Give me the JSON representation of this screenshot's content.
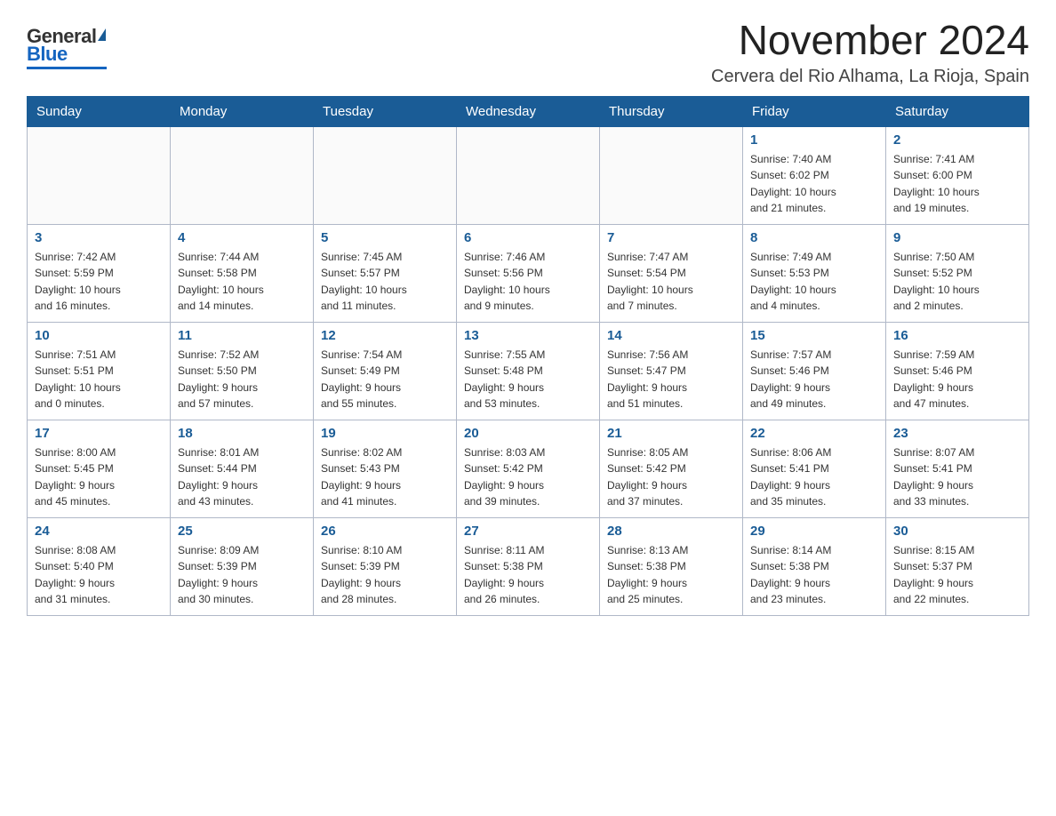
{
  "header": {
    "logo_general": "General",
    "logo_blue": "Blue",
    "month_title": "November 2024",
    "location": "Cervera del Rio Alhama, La Rioja, Spain"
  },
  "days_of_week": [
    "Sunday",
    "Monday",
    "Tuesday",
    "Wednesday",
    "Thursday",
    "Friday",
    "Saturday"
  ],
  "weeks": [
    [
      {
        "day": "",
        "info": ""
      },
      {
        "day": "",
        "info": ""
      },
      {
        "day": "",
        "info": ""
      },
      {
        "day": "",
        "info": ""
      },
      {
        "day": "",
        "info": ""
      },
      {
        "day": "1",
        "info": "Sunrise: 7:40 AM\nSunset: 6:02 PM\nDaylight: 10 hours\nand 21 minutes."
      },
      {
        "day": "2",
        "info": "Sunrise: 7:41 AM\nSunset: 6:00 PM\nDaylight: 10 hours\nand 19 minutes."
      }
    ],
    [
      {
        "day": "3",
        "info": "Sunrise: 7:42 AM\nSunset: 5:59 PM\nDaylight: 10 hours\nand 16 minutes."
      },
      {
        "day": "4",
        "info": "Sunrise: 7:44 AM\nSunset: 5:58 PM\nDaylight: 10 hours\nand 14 minutes."
      },
      {
        "day": "5",
        "info": "Sunrise: 7:45 AM\nSunset: 5:57 PM\nDaylight: 10 hours\nand 11 minutes."
      },
      {
        "day": "6",
        "info": "Sunrise: 7:46 AM\nSunset: 5:56 PM\nDaylight: 10 hours\nand 9 minutes."
      },
      {
        "day": "7",
        "info": "Sunrise: 7:47 AM\nSunset: 5:54 PM\nDaylight: 10 hours\nand 7 minutes."
      },
      {
        "day": "8",
        "info": "Sunrise: 7:49 AM\nSunset: 5:53 PM\nDaylight: 10 hours\nand 4 minutes."
      },
      {
        "day": "9",
        "info": "Sunrise: 7:50 AM\nSunset: 5:52 PM\nDaylight: 10 hours\nand 2 minutes."
      }
    ],
    [
      {
        "day": "10",
        "info": "Sunrise: 7:51 AM\nSunset: 5:51 PM\nDaylight: 10 hours\nand 0 minutes."
      },
      {
        "day": "11",
        "info": "Sunrise: 7:52 AM\nSunset: 5:50 PM\nDaylight: 9 hours\nand 57 minutes."
      },
      {
        "day": "12",
        "info": "Sunrise: 7:54 AM\nSunset: 5:49 PM\nDaylight: 9 hours\nand 55 minutes."
      },
      {
        "day": "13",
        "info": "Sunrise: 7:55 AM\nSunset: 5:48 PM\nDaylight: 9 hours\nand 53 minutes."
      },
      {
        "day": "14",
        "info": "Sunrise: 7:56 AM\nSunset: 5:47 PM\nDaylight: 9 hours\nand 51 minutes."
      },
      {
        "day": "15",
        "info": "Sunrise: 7:57 AM\nSunset: 5:46 PM\nDaylight: 9 hours\nand 49 minutes."
      },
      {
        "day": "16",
        "info": "Sunrise: 7:59 AM\nSunset: 5:46 PM\nDaylight: 9 hours\nand 47 minutes."
      }
    ],
    [
      {
        "day": "17",
        "info": "Sunrise: 8:00 AM\nSunset: 5:45 PM\nDaylight: 9 hours\nand 45 minutes."
      },
      {
        "day": "18",
        "info": "Sunrise: 8:01 AM\nSunset: 5:44 PM\nDaylight: 9 hours\nand 43 minutes."
      },
      {
        "day": "19",
        "info": "Sunrise: 8:02 AM\nSunset: 5:43 PM\nDaylight: 9 hours\nand 41 minutes."
      },
      {
        "day": "20",
        "info": "Sunrise: 8:03 AM\nSunset: 5:42 PM\nDaylight: 9 hours\nand 39 minutes."
      },
      {
        "day": "21",
        "info": "Sunrise: 8:05 AM\nSunset: 5:42 PM\nDaylight: 9 hours\nand 37 minutes."
      },
      {
        "day": "22",
        "info": "Sunrise: 8:06 AM\nSunset: 5:41 PM\nDaylight: 9 hours\nand 35 minutes."
      },
      {
        "day": "23",
        "info": "Sunrise: 8:07 AM\nSunset: 5:41 PM\nDaylight: 9 hours\nand 33 minutes."
      }
    ],
    [
      {
        "day": "24",
        "info": "Sunrise: 8:08 AM\nSunset: 5:40 PM\nDaylight: 9 hours\nand 31 minutes."
      },
      {
        "day": "25",
        "info": "Sunrise: 8:09 AM\nSunset: 5:39 PM\nDaylight: 9 hours\nand 30 minutes."
      },
      {
        "day": "26",
        "info": "Sunrise: 8:10 AM\nSunset: 5:39 PM\nDaylight: 9 hours\nand 28 minutes."
      },
      {
        "day": "27",
        "info": "Sunrise: 8:11 AM\nSunset: 5:38 PM\nDaylight: 9 hours\nand 26 minutes."
      },
      {
        "day": "28",
        "info": "Sunrise: 8:13 AM\nSunset: 5:38 PM\nDaylight: 9 hours\nand 25 minutes."
      },
      {
        "day": "29",
        "info": "Sunrise: 8:14 AM\nSunset: 5:38 PM\nDaylight: 9 hours\nand 23 minutes."
      },
      {
        "day": "30",
        "info": "Sunrise: 8:15 AM\nSunset: 5:37 PM\nDaylight: 9 hours\nand 22 minutes."
      }
    ]
  ]
}
